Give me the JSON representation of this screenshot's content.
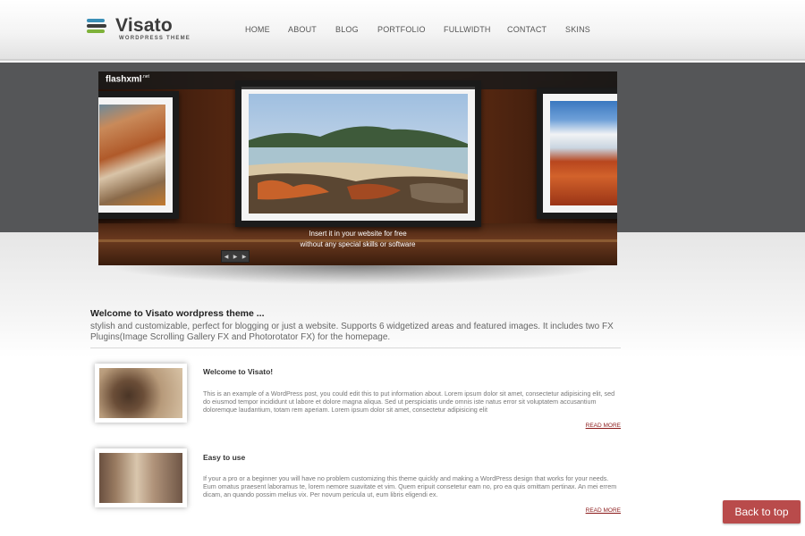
{
  "brand": {
    "title": "Visato",
    "subtitle": "WORDPRESS THEME",
    "logo_colors": [
      "#3a8fb7",
      "#3c3c3c",
      "#7fb23a"
    ]
  },
  "nav": {
    "items": [
      {
        "label": "HOME"
      },
      {
        "label": "ABOUT"
      },
      {
        "label": "BLOG"
      },
      {
        "label": "PORTFOLIO"
      },
      {
        "label": "FULLWIDTH"
      },
      {
        "label": "CONTACT"
      },
      {
        "label": "SKINS"
      }
    ]
  },
  "slider": {
    "brand": "flashxml",
    "brand_suffix": ".net",
    "caption_line1": "Insert it in your website for free",
    "caption_line2": "without any special skills or software",
    "controls_icon": "play-pause-icon"
  },
  "welcome": {
    "title": "Welcome to Visato wordpress theme ...",
    "text": "stylish and customizable, perfect for blogging or just a website. Supports 6 widgetized areas and featured images. It includes two FX Plugins(Image Scrolling Gallery FX and Photorotator FX) for the homepage."
  },
  "posts": [
    {
      "title": "Welcome to Visato!",
      "body": "This is an example of a WordPress post, you could edit this to put information about. Lorem ipsum dolor sit amet, consectetur adipisicing elit, sed do eiusmod tempor incididunt ut labore et dolore magna aliqua. Sed ut perspiciatis unde omnis iste natus error sit voluptatem accusantium doloremque laudantium, totam rem aperiam. Lorem ipsum dolor sit amet, consectetur adipisicing elit",
      "read_more": "READ MORE"
    },
    {
      "title": "Easy to use",
      "body": "If your a pro or a beginner you will have no problem customizing this theme quickly and making a WordPress design that works for your needs. Eum omatus praesent laboramus te, lorem nemore suavitate et vim. Quem eripuit consetetur eam no, pro ea quis omittam pertinax. An mei errem dicam, an quando possim melius vix. Per novum pericula ut, eum libris eligendi ex.",
      "read_more": "READ MORE"
    }
  ],
  "back_to_top": "Back to top"
}
